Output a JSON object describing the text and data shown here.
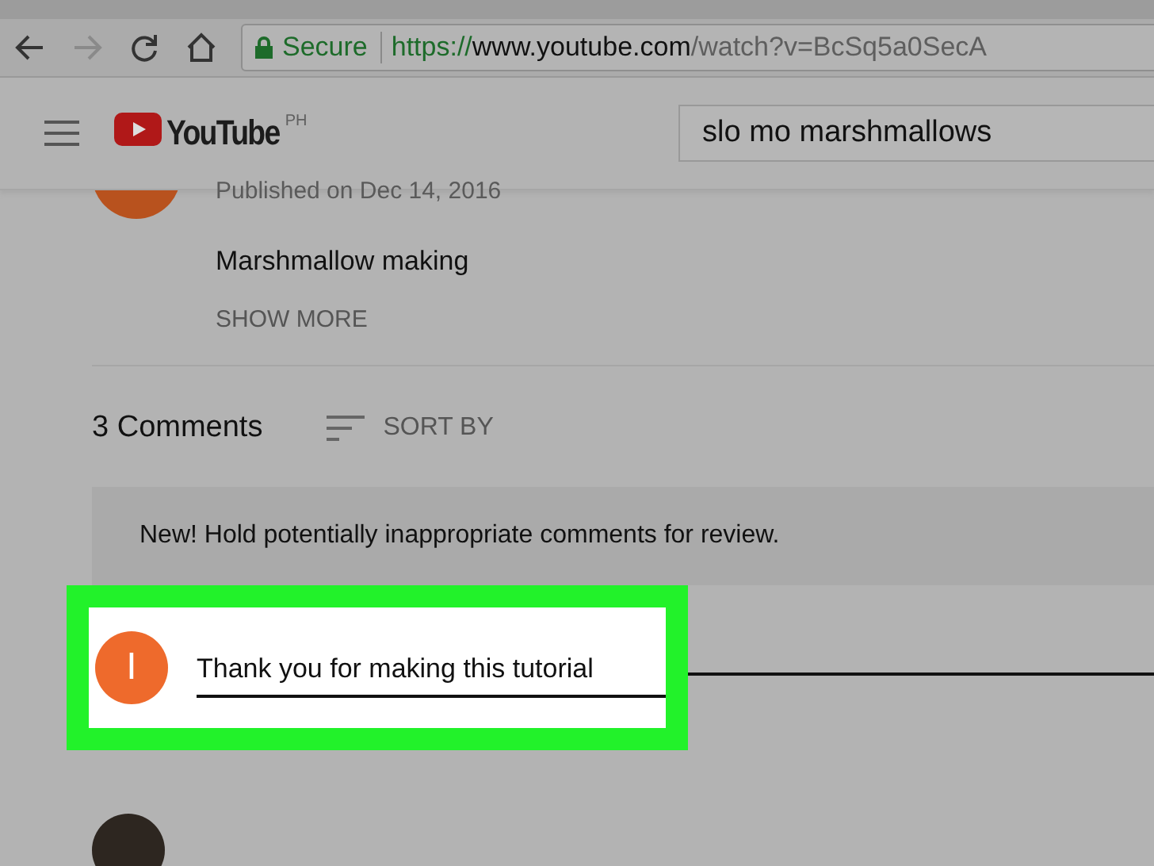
{
  "browser": {
    "secure_label": "Secure",
    "url": {
      "scheme": "https://",
      "host": "www.youtube.com",
      "path": "/watch?v=BcSq5a0SecA"
    }
  },
  "header": {
    "logo_text": "YouTube",
    "region": "PH",
    "search_value": "slo mo marshmallows"
  },
  "video": {
    "published": "Published on Dec 14, 2016",
    "description": "Marshmallow making",
    "show_more": "SHOW MORE"
  },
  "comments": {
    "count": "3 Comments",
    "sort_label": "SORT BY",
    "notice": "New! Hold potentially inappropriate comments for review.",
    "composer": {
      "avatar_letter": "I",
      "value": "Thank you for making this tutorial",
      "highlighted": true
    }
  }
}
